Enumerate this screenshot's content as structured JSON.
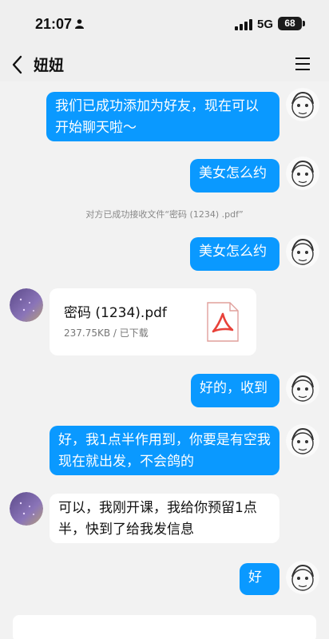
{
  "status_bar": {
    "time": "21:07",
    "network": "5G",
    "battery": "68"
  },
  "header": {
    "title": "妞妞"
  },
  "messages": {
    "m1": "我们已成功添加为好友，现在可以开始聊天啦～",
    "m2": "美女怎么约",
    "system_note": "对方已成功接收文件“密码 (1234) .pdf”",
    "m3": "美女怎么约",
    "file": {
      "name": "密码 (1234).pdf",
      "size": "237.75KB",
      "separator": " / ",
      "status": "已下载"
    },
    "m4": "好的，收到",
    "m5": "好，我1点半作用到，你要是有空我现在就出发，不会鸽的",
    "m6": "可以，我刚开课，我给你预留1点半，快到了给我发信息",
    "m7": "好"
  },
  "colors": {
    "outgoing_bubble": "#0a99ff",
    "incoming_bubble": "#ffffff",
    "background": "#f2f2f2",
    "pdf_red": "#e8423a"
  },
  "icons": {
    "back": "chevron-left-icon",
    "menu": "hamburger-menu-icon",
    "pdf": "pdf-file-icon",
    "signal": "cellular-signal-icon",
    "battery": "battery-icon"
  }
}
